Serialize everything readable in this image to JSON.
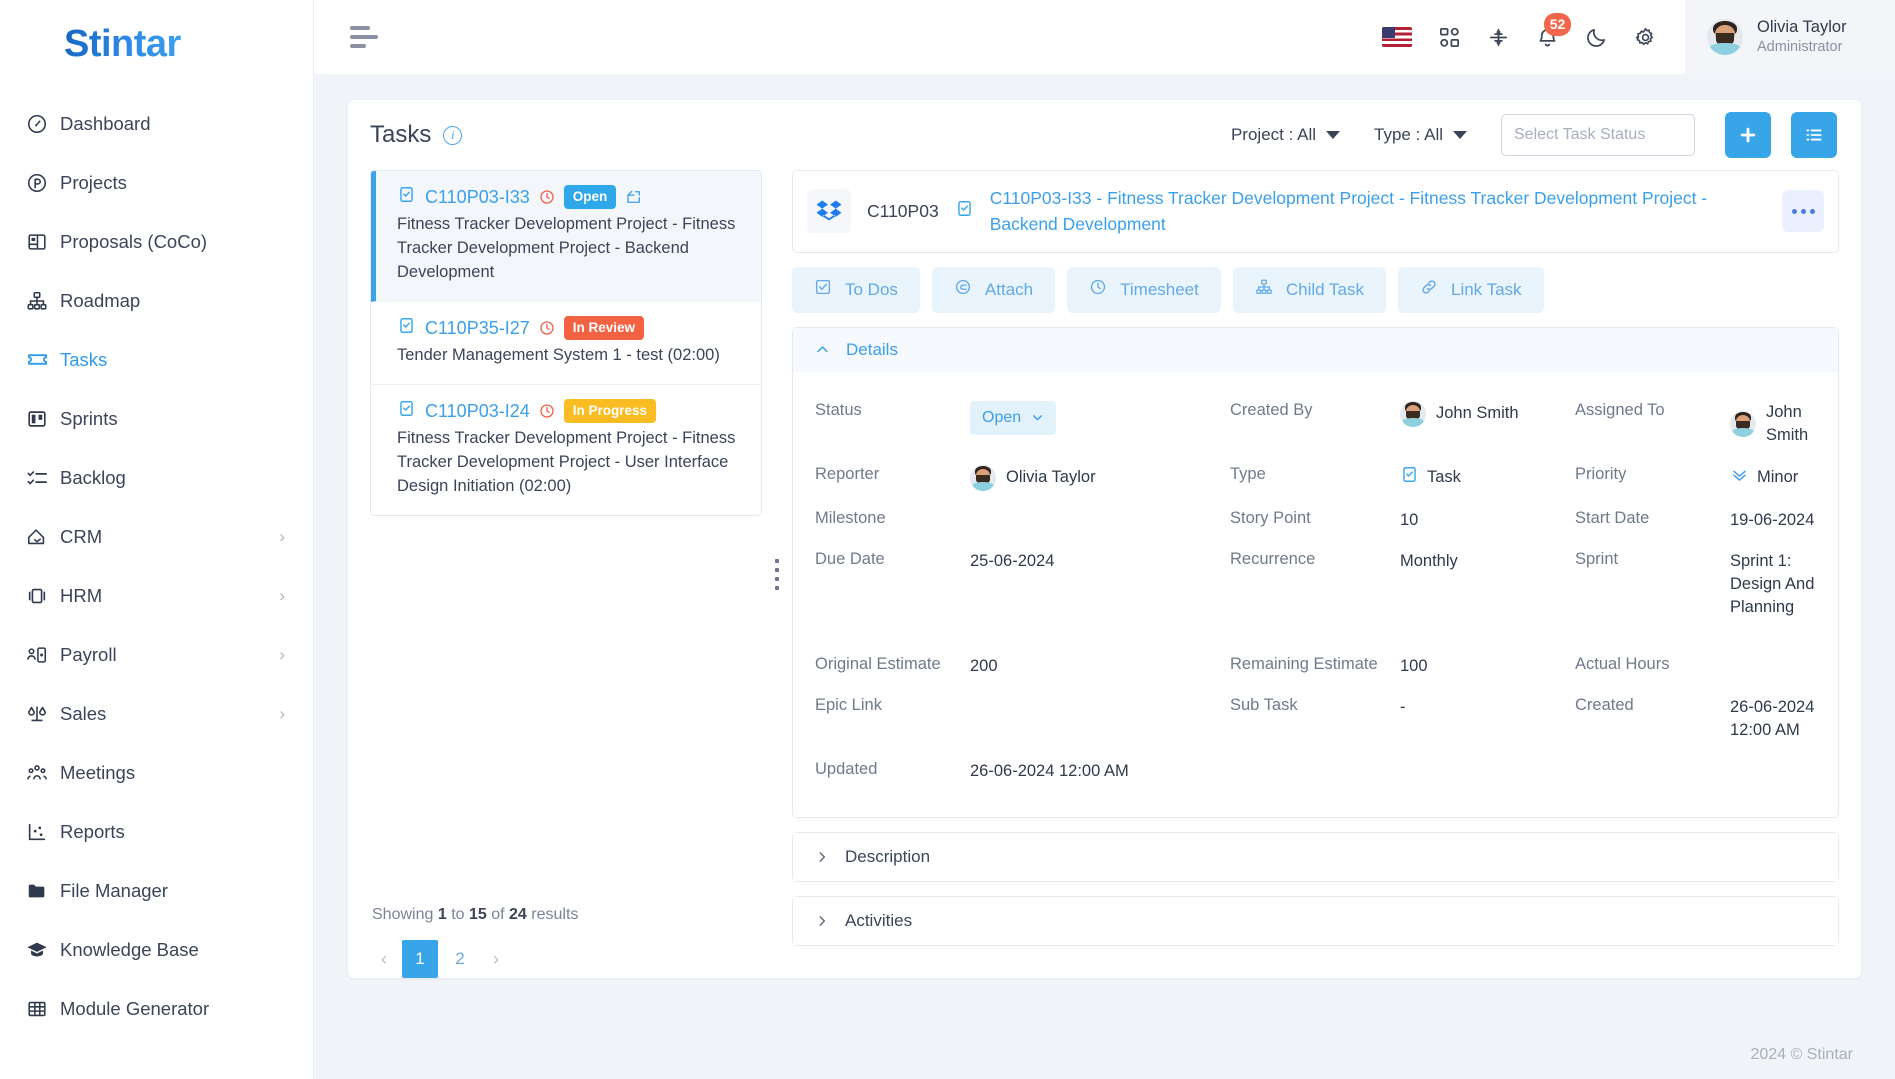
{
  "sidebar": {
    "brand": "Stintar",
    "items": [
      {
        "label": "Dashboard",
        "icon": "gauge-icon",
        "active": false,
        "expandable": false
      },
      {
        "label": "Projects",
        "icon": "circle-p-icon",
        "active": false,
        "expandable": false
      },
      {
        "label": "Proposals (CoCo)",
        "icon": "layout-icon",
        "active": false,
        "expandable": false
      },
      {
        "label": "Roadmap",
        "icon": "sitemap-icon",
        "active": false,
        "expandable": false
      },
      {
        "label": "Tasks",
        "icon": "ticket-icon",
        "active": true,
        "expandable": false
      },
      {
        "label": "Sprints",
        "icon": "board-icon",
        "active": false,
        "expandable": false
      },
      {
        "label": "Backlog",
        "icon": "checklist-icon",
        "active": false,
        "expandable": false
      },
      {
        "label": "CRM",
        "icon": "handshake-icon",
        "active": false,
        "expandable": true
      },
      {
        "label": "HRM",
        "icon": "briefcase-icon",
        "active": false,
        "expandable": true
      },
      {
        "label": "Payroll",
        "icon": "user-card-icon",
        "active": false,
        "expandable": true
      },
      {
        "label": "Sales",
        "icon": "scale-icon",
        "active": false,
        "expandable": true
      },
      {
        "label": "Meetings",
        "icon": "people-icon",
        "active": false,
        "expandable": false
      },
      {
        "label": "Reports",
        "icon": "chart-dots-icon",
        "active": false,
        "expandable": false
      },
      {
        "label": "File Manager",
        "icon": "folder-icon",
        "active": false,
        "expandable": false
      },
      {
        "label": "Knowledge Base",
        "icon": "graduation-cap-icon",
        "active": false,
        "expandable": false
      },
      {
        "label": "Module Generator",
        "icon": "grid-table-icon",
        "active": false,
        "expandable": false
      }
    ]
  },
  "topbar": {
    "menu_toggle": "hamburger-icon",
    "icons": [
      "flag-us-icon",
      "apps-grid-icon",
      "compress-icon",
      "bell-icon",
      "moon-icon",
      "gear-icon"
    ],
    "notification_count": "52",
    "user": {
      "name": "Olivia Taylor",
      "role": "Administrator"
    }
  },
  "page": {
    "title": "Tasks",
    "filters": [
      {
        "label": "Project : All"
      },
      {
        "label": "Type : All"
      }
    ],
    "status_select_placeholder": "Select Task Status",
    "status_select_value": "",
    "add_button": "+",
    "list_button": "list-icon"
  },
  "task_list": {
    "items": [
      {
        "key": "C110P03-I33",
        "status": "Open",
        "status_kind": "open",
        "title": "Fitness Tracker Development Project - Fitness Tracker Development Project - Backend Development",
        "selected": true,
        "avatar": "photo",
        "has_recurrence_icon": true
      },
      {
        "key": "C110P35-I27",
        "status": "In Review",
        "status_kind": "review",
        "title": "Tender Management System 1 - test (02:00)",
        "selected": false,
        "avatar": "silhouette",
        "has_recurrence_icon": false
      },
      {
        "key": "C110P03-I24",
        "status": "In Progress",
        "status_kind": "progress",
        "title": "Fitness Tracker Development Project - Fitness Tracker Development Project - User Interface Design Initiation (02:00)",
        "selected": false,
        "avatar": "photo",
        "has_recurrence_icon": false
      }
    ],
    "showing_prefix": "Showing",
    "showing_from": "1",
    "showing_to_word": "to",
    "showing_to": "15",
    "showing_of_word": "of",
    "showing_total": "24",
    "showing_suffix": "results",
    "pagination": {
      "prev": "‹",
      "pages": [
        "1",
        "2"
      ],
      "active": "1",
      "next": "›"
    }
  },
  "detail": {
    "project_code": "C110P03",
    "title": "C110P03-I33 - Fitness Tracker Development Project - Fitness Tracker Development Project - Backend Development",
    "more_button": "more-options-icon",
    "tabs": [
      {
        "label": "To Dos",
        "icon": "checkbox-icon"
      },
      {
        "label": "Attach",
        "icon": "paperclip-icon"
      },
      {
        "label": "Timesheet",
        "icon": "clock-icon"
      },
      {
        "label": "Child Task",
        "icon": "sitemap-icon"
      },
      {
        "label": "Link Task",
        "icon": "link-icon"
      }
    ],
    "details_section": {
      "title": "Details",
      "expanded": true,
      "fields": {
        "status_label": "Status",
        "status_value": "Open",
        "created_by_label": "Created By",
        "created_by_value": "John Smith",
        "assigned_to_label": "Assigned To",
        "assigned_to_value": "John Smith",
        "reporter_label": "Reporter",
        "reporter_value": "Olivia Taylor",
        "type_label": "Type",
        "type_value": "Task",
        "priority_label": "Priority",
        "priority_value": "Minor",
        "milestone_label": "Milestone",
        "milestone_value": "",
        "story_point_label": "Story Point",
        "story_point_value": "10",
        "start_date_label": "Start Date",
        "start_date_value": "19-06-2024",
        "due_date_label": "Due Date",
        "due_date_value": "25-06-2024",
        "recurrence_label": "Recurrence",
        "recurrence_value": "Monthly",
        "sprint_label": "Sprint",
        "sprint_value": "Sprint 1: Design And Planning",
        "original_estimate_label": "Original Estimate",
        "original_estimate_value": "200",
        "remaining_estimate_label": "Remaining Estimate",
        "remaining_estimate_value": "100",
        "actual_hours_label": "Actual Hours",
        "actual_hours_value": "",
        "epic_link_label": "Epic Link",
        "epic_link_value": "",
        "sub_task_label": "Sub Task",
        "sub_task_value": "-",
        "created_label": "Created",
        "created_value": "26-06-2024 12:00 AM",
        "updated_label": "Updated",
        "updated_value": "26-06-2024 12:00 AM"
      }
    },
    "description_section": {
      "title": "Description",
      "expanded": false
    },
    "activities_section": {
      "title": "Activities",
      "expanded": false
    }
  },
  "footer": {
    "copyright": "2024 © Stintar"
  },
  "colors": {
    "accent": "#38a5e9",
    "open": "#2fa8ea",
    "review": "#f36242",
    "progress": "#f9bc22",
    "badge": "#f1674b",
    "sidebar_bg": "#ffffff",
    "page_bg": "#f1f4f9"
  }
}
